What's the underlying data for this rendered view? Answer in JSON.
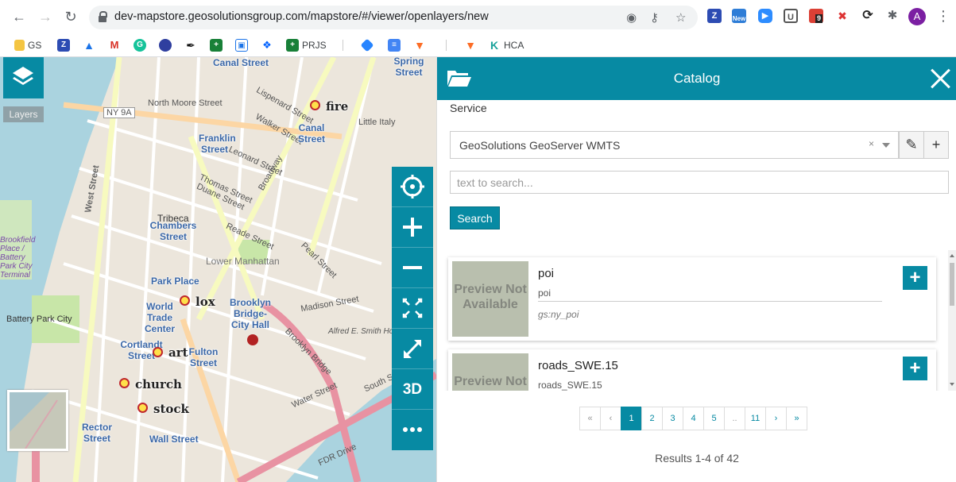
{
  "browser": {
    "url": "dev-mapstore.geosolutionsgroup.com/mapstore/#/viewer/openlayers/new",
    "avatar_letter": "A",
    "extension_badges": {
      "new": "New",
      "count": "9"
    },
    "bookmarks": [
      "GS",
      "PRJS",
      "HCA"
    ]
  },
  "map": {
    "layers_tooltip": "Layers",
    "tools": {
      "three_d": "3D"
    },
    "poi_labels": [
      "fire",
      "lox",
      "art",
      "church",
      "stock"
    ],
    "street_labels": [
      "Canal Street",
      "Spring Street",
      "North Moore Street",
      "Franklin Street",
      "Lispenard Street",
      "Walker Street",
      "Canal Street",
      "Little Italy",
      "Leonard Street",
      "Thomas Street",
      "Duane Street",
      "Tribeca",
      "Chambers Street",
      "Reade Street",
      "Park Place",
      "Lower Manhattan",
      "Brooklyn Bridge-City Hall",
      "World Trade Center",
      "Cortlandt Street",
      "Fulton Street",
      "Battery Park City",
      "Rector Street",
      "Wall Street",
      "Madison Street",
      "Pearl Street",
      "Brooklyn Bridge",
      "FDR Drive",
      "South Street",
      "Water Street",
      "West Street",
      "Broadway",
      "Alfred E. Smith Houses",
      "NY 9A",
      "Canal Street",
      "Brookfield Place / Battery Park City Terminal",
      "Spring Street"
    ],
    "route_shield": "NY 9A"
  },
  "catalog": {
    "title": "Catalog",
    "service_label": "Service",
    "service_value": "GeoSolutions GeoServer WMTS",
    "search_placeholder": "text to search...",
    "search_button": "Search",
    "records": [
      {
        "title": "poi",
        "description": "poi",
        "identifier": "gs:ny_poi",
        "preview": "Preview Not Available"
      },
      {
        "title": "roads_SWE.15",
        "description": "roads_SWE.15",
        "identifier": "",
        "preview": "Preview Not Available"
      }
    ],
    "pagination": [
      "«",
      "‹",
      "1",
      "2",
      "3",
      "4",
      "5",
      "..",
      "11",
      "›",
      "»"
    ],
    "active_page": "1",
    "results_text": "Results 1-4 of 42"
  },
  "colors": {
    "accent": "#078aa3",
    "poi_fill": "#ffe04a",
    "poi_stroke": "#c0272d"
  }
}
